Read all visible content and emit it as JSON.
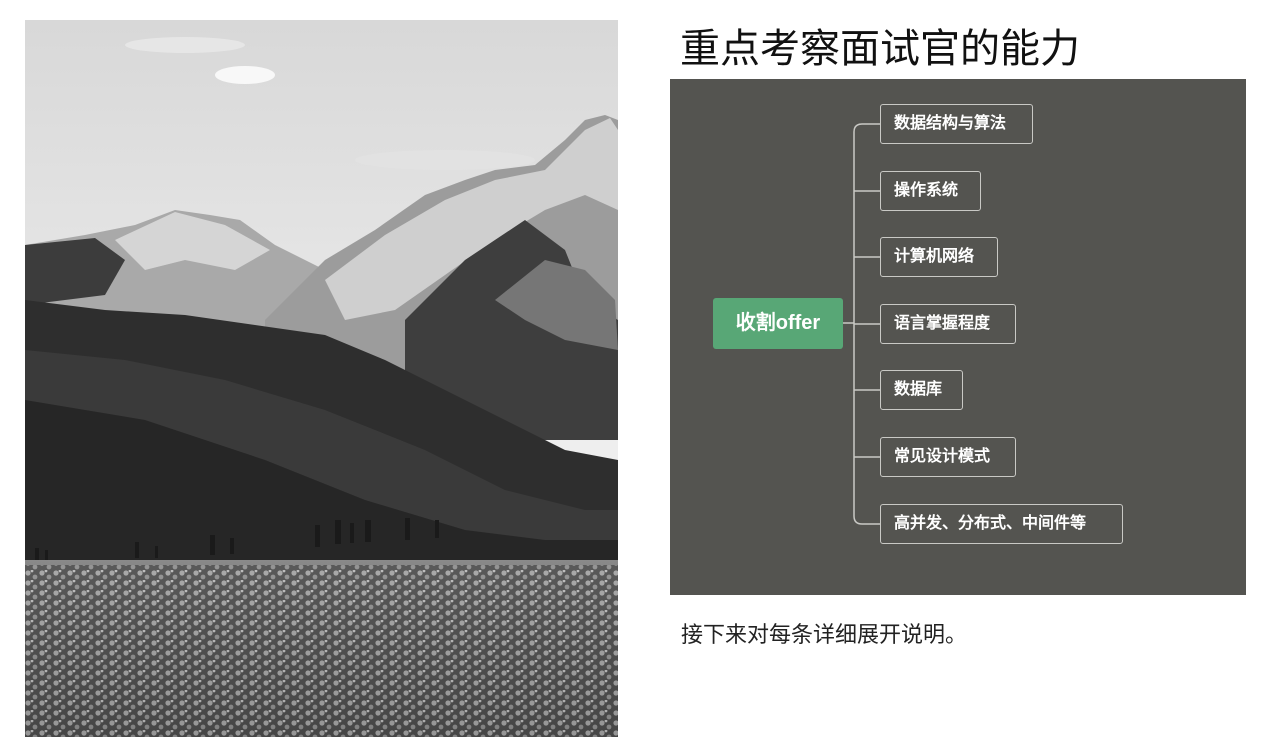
{
  "slide": {
    "title": "重点考察面试官的能力",
    "caption": "接下来对每条详细展开说明。"
  },
  "mindmap": {
    "root": "收割offer",
    "branches": [
      "数据结构与算法",
      "操作系统",
      "计算机网络",
      "语言掌握程度",
      "数据库",
      "常见设计模式",
      "高并发、分布式、中间件等"
    ]
  },
  "colors": {
    "mindmap_background": "#545450",
    "root_node": "#58a776",
    "branch_border": "#c9c9c5"
  }
}
